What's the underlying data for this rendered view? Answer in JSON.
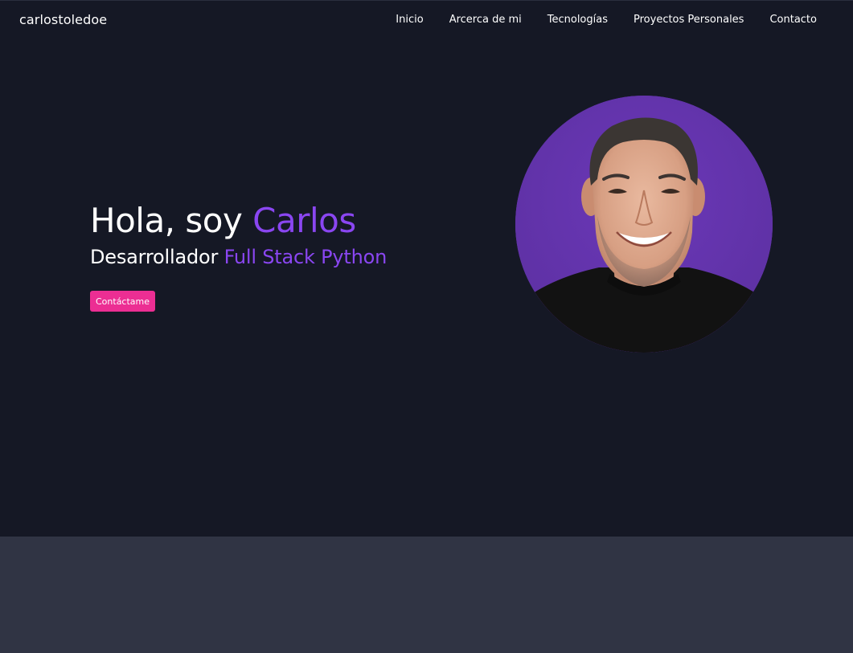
{
  "navbar": {
    "brand": "carlostoledoe",
    "links": [
      "Inicio",
      "Arcerca de mi",
      "Tecnologías",
      "Proyectos Personales",
      "Contacto"
    ]
  },
  "hero": {
    "greeting": "Hola, soy ",
    "name": "Carlos",
    "role_prefix": "Desarrollador ",
    "role_highlight": "Full Stack Python",
    "cta_label": "Contáctame"
  },
  "colors": {
    "background": "#151825",
    "accent": "#8a46f1",
    "cta": "#ec2e93",
    "avatar_background": "#6535ae",
    "section_below": "#303444"
  }
}
